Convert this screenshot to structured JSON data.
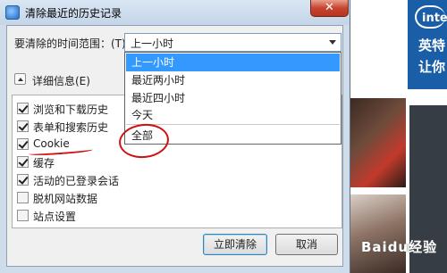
{
  "window": {
    "title": "清除最近的历史记录",
    "close_label": "✕"
  },
  "time_range": {
    "label": "要清除的时间范围：(T)",
    "selected": "上一小时",
    "options": [
      "上一小时",
      "最近两小时",
      "最近四小时",
      "今天",
      "全部"
    ]
  },
  "details": {
    "label": "详细信息(E)"
  },
  "options": [
    {
      "label": "浏览和下载历史",
      "checked": true
    },
    {
      "label": "表单和搜索历史",
      "checked": true
    },
    {
      "label": "Cookie",
      "checked": true
    },
    {
      "label": "缓存",
      "checked": true
    },
    {
      "label": "活动的已登录会话",
      "checked": true
    },
    {
      "label": "脱机网站数据",
      "checked": false
    },
    {
      "label": "站点设置",
      "checked": false
    }
  ],
  "buttons": {
    "clear_now": "立即清除",
    "cancel": "取消"
  },
  "background": {
    "ad_logo": "intel",
    "ad_line1": "英特",
    "ad_line2": "让你",
    "watermark": "Baidu经验"
  },
  "colors": {
    "selection": "#3399ff",
    "annotation": "#d01010"
  }
}
